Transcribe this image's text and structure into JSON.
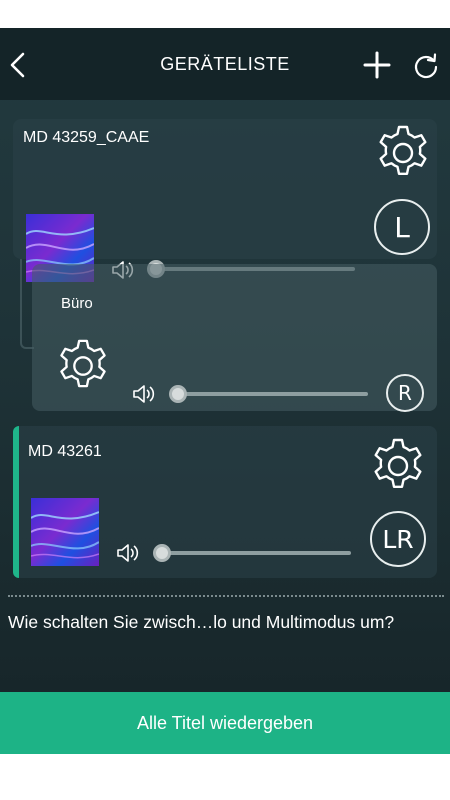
{
  "header": {
    "title": "GERÄTELISTE",
    "back_icon": "chevron-left-icon",
    "add_icon": "plus-icon",
    "refresh_icon": "refresh-icon"
  },
  "devices": [
    {
      "name": "MD 43259_CAAE",
      "channel": "L",
      "volume": 0.0,
      "selected": false
    },
    {
      "name": "MD 43261",
      "channel": "LR",
      "volume": 0.0,
      "selected": true
    }
  ],
  "group": {
    "name": "Büro",
    "channel": "R",
    "volume": 0.0
  },
  "help_text": "Wie schalten Sie zwisch…lo und Multimodus um?",
  "play_all_label": "Alle Titel wiedergeben",
  "colors": {
    "accent": "#1db386",
    "header_bg": "#142428",
    "background": "#1f3439"
  }
}
